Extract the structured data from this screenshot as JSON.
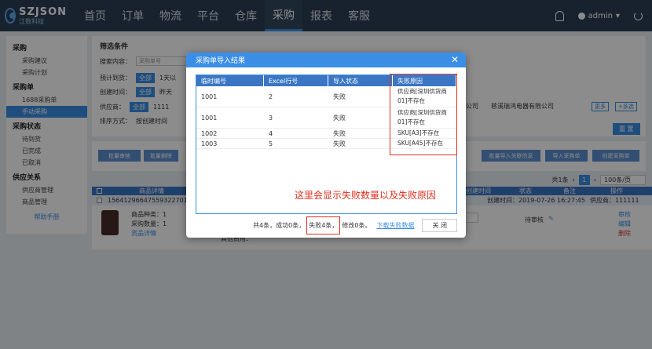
{
  "brand": {
    "name": "SZJSON",
    "sub": "江数科技"
  },
  "nav": [
    "首页",
    "订单",
    "物流",
    "平台",
    "仓库",
    "采购",
    "报表",
    "客服"
  ],
  "nav_active": "采购",
  "user": {
    "name": "admin"
  },
  "sidebar": [
    {
      "group": "采购",
      "items": [
        "采购建议",
        "采购计划"
      ]
    },
    {
      "group": "采购单",
      "items": [
        "1688采购单",
        "手动采购"
      ]
    },
    {
      "group": "采购状态",
      "items": [
        "待到货",
        "已完成",
        "已取消"
      ]
    },
    {
      "group": "供应关系",
      "items": [
        "供应商管理",
        "商品管理"
      ]
    }
  ],
  "sidebar_active": "手动采购",
  "help_link": "帮助手册",
  "filter": {
    "title": "筛选条件",
    "search_label": "搜索内容：",
    "search_placeholder": "采购单号",
    "arrive_label": "预计到货：",
    "arrive_chip": "全部",
    "arrive_opt": "1天以",
    "create_label": "创建时间：",
    "create_chip": "全部",
    "create_opt": "昨天",
    "supplier_label": "供应商：",
    "supplier_chip": "全部",
    "supplier_opt": "1111",
    "supplier_extra1": "公司",
    "supplier_extra2": "慈溪瑞鸿电器有限公司",
    "more_btn": "更多",
    "multi_btn": "+多选",
    "sort_label": "排序方式：",
    "sort_opt": "按创建时间",
    "reset_btn": "重 置"
  },
  "actions": {
    "batch_audit": "批量审核",
    "batch_delete": "批量删除",
    "batch_import_link": "批量导入关联信息",
    "import_purchase": "导入采购单",
    "create_purchase": "创建采购单"
  },
  "pager": {
    "total": "共1条",
    "page": "1",
    "page_size": "100条/页"
  },
  "list": {
    "head": {
      "product": "商品详情",
      "create_time": "创建时间",
      "status": "状态",
      "remark": "备注",
      "op": "操作"
    },
    "order_no": "15641296647559322701",
    "created": "创建时间：2019-07-26 16:27:45",
    "supplier": "供应商：111111",
    "kinds": "商品种类：1",
    "qty": "采购数量：1",
    "goods_detail": "货品详情",
    "other_fee": "其他费用：",
    "status": "待审核",
    "op_audit": "审核",
    "op_edit": "编辑",
    "op_delete": "删除"
  },
  "modal": {
    "title": "采购单导入结果",
    "columns": [
      "临时编号",
      "Excel行号",
      "导入状态",
      "失败原因"
    ],
    "rows": [
      {
        "id": "1001",
        "line": "2",
        "status": "失败",
        "reason": [
          "供应商[深圳供货商",
          "01]不存在"
        ]
      },
      {
        "id": "1001",
        "line": "3",
        "status": "失败",
        "reason": [
          "供应商[深圳供货商",
          "01]不存在"
        ]
      },
      {
        "id": "1002",
        "line": "4",
        "status": "失败",
        "reason": [
          "SKU[A3]不存在"
        ]
      },
      {
        "id": "1003",
        "line": "5",
        "status": "失败",
        "reason": [
          "SKU[A45]不存在"
        ]
      }
    ],
    "annotation": "这里会显示失败数量以及失败原因",
    "summary_pre": "共4条，成功0条，",
    "summary_fail": "失败4条，",
    "summary_post": "修改0条。",
    "download_link": "下载失败数据",
    "close_btn": "关 闭"
  }
}
